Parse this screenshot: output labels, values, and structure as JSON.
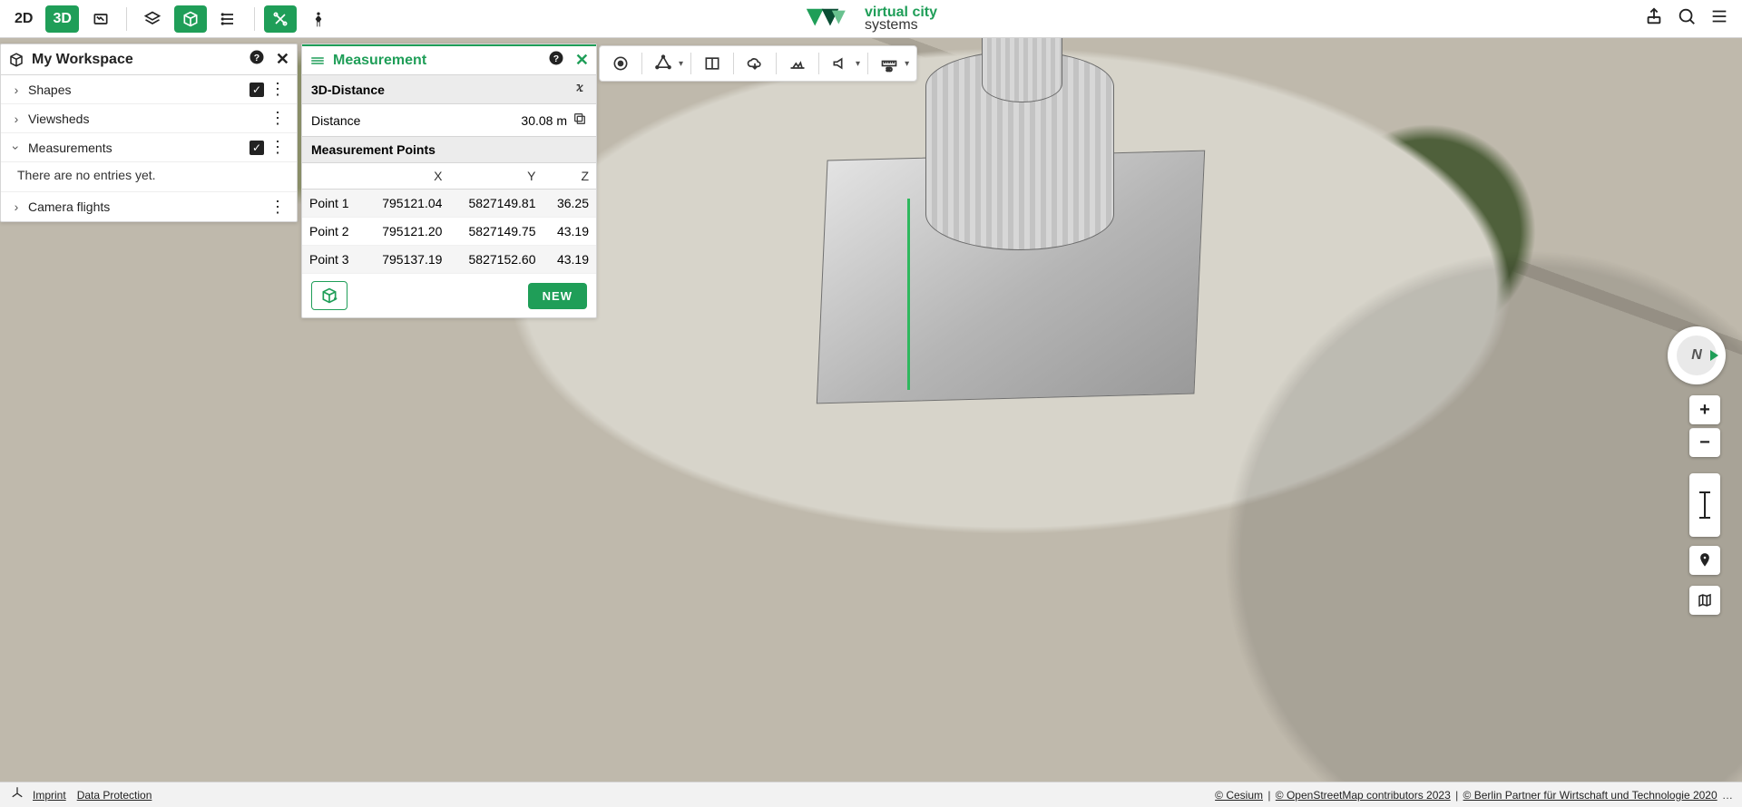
{
  "brand": {
    "line1": "virtual city",
    "line2": "systems"
  },
  "topbar": {
    "view2d": "2D",
    "view3d": "3D"
  },
  "workspace": {
    "title": "My Workspace",
    "items": {
      "shapes": "Shapes",
      "viewsheds": "Viewsheds",
      "measurements": "Measurements",
      "empty_msg": "There are no entries yet.",
      "flights": "Camera flights"
    }
  },
  "measure": {
    "title": "Measurement",
    "mode": "3D-Distance",
    "distance_label": "Distance",
    "distance_value": "30.08 m",
    "points_title": "Measurement Points",
    "cols": {
      "x": "X",
      "y": "Y",
      "z": "Z"
    },
    "points": [
      {
        "name": "Point 1",
        "x": "795121.04",
        "y": "5827149.81",
        "z": "36.25"
      },
      {
        "name": "Point 2",
        "x": "795121.20",
        "y": "5827149.75",
        "z": "43.19"
      },
      {
        "name": "Point 3",
        "x": "795137.19",
        "y": "5827152.60",
        "z": "43.19"
      }
    ],
    "new_label": "NEW"
  },
  "compass": {
    "letter": "N"
  },
  "zoom": {
    "in": "+",
    "out": "−"
  },
  "footer": {
    "imprint": "Imprint",
    "privacy": "Data Protection",
    "attribution": {
      "cesium": "© Cesium",
      "osm": "© OpenStreetMap contributors 2023",
      "berlin": "© Berlin Partner für Wirtschaft und Technologie 2020",
      "sep": " | "
    }
  }
}
